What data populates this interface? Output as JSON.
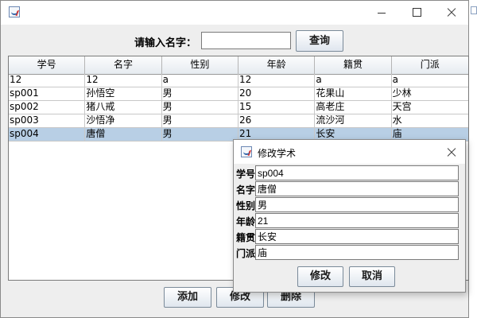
{
  "search": {
    "label": "请输入名字：",
    "value": "",
    "button": "查询"
  },
  "table": {
    "columns": [
      "学号",
      "名字",
      "性别",
      "年龄",
      "籍贯",
      "门派"
    ],
    "rows": [
      [
        "12",
        "12",
        "a",
        "12",
        "a",
        "a"
      ],
      [
        "sp001",
        "孙悟空",
        "男",
        "20",
        "花果山",
        "少林"
      ],
      [
        "sp002",
        "猪八戒",
        "男",
        "15",
        "高老庄",
        "天宫"
      ],
      [
        "sp003",
        "沙悟净",
        "男",
        "26",
        "流沙河",
        "水"
      ],
      [
        "sp004",
        "唐僧",
        "男",
        "21",
        "长安",
        "庙"
      ]
    ],
    "selected_row": 4
  },
  "actions": {
    "add": "添加",
    "edit": "修改",
    "delete": "删除"
  },
  "dialog": {
    "title": "修改学术",
    "fields": [
      {
        "label": "学号",
        "value": "sp004"
      },
      {
        "label": "名字",
        "value": "唐僧"
      },
      {
        "label": "性别",
        "value": "男"
      },
      {
        "label": "年龄",
        "value": "21"
      },
      {
        "label": "籍贯",
        "value": "长安"
      },
      {
        "label": "门派",
        "value": "庙"
      }
    ],
    "confirm": "修改",
    "cancel": "取消"
  },
  "icons": {
    "app": "java-cup-icon",
    "minimize": "minimize-icon",
    "maximize": "maximize-icon",
    "close": "close-icon"
  },
  "colors": {
    "selection": "#b8cfe5",
    "window_bg": "#eeeeee"
  }
}
